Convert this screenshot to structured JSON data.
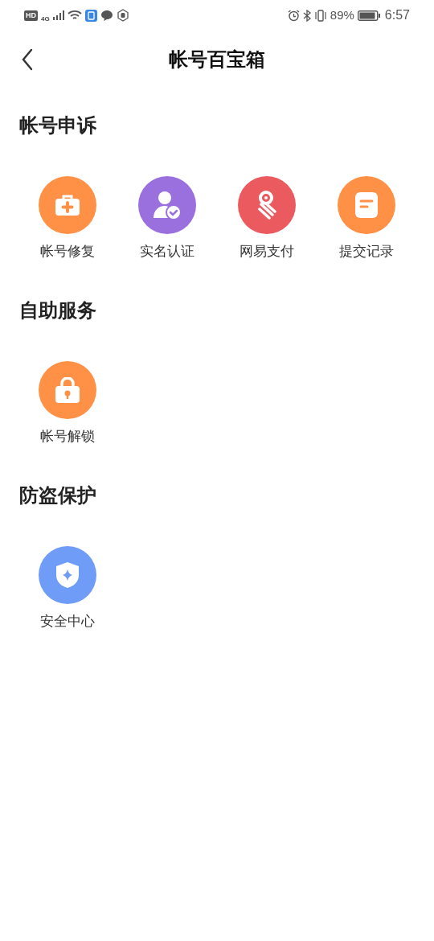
{
  "status_bar": {
    "hd": "HD",
    "network": "4G",
    "battery_percent": "89%",
    "time": "6:57"
  },
  "header": {
    "title": "帐号百宝箱"
  },
  "sections": [
    {
      "title": "帐号申诉",
      "items": [
        {
          "label": "帐号修复",
          "kind": "medkit",
          "color": "#ff9147"
        },
        {
          "label": "实名认证",
          "kind": "user-check",
          "color": "#9a70df"
        },
        {
          "label": "网易支付",
          "kind": "payment",
          "color": "#ea5a5e"
        },
        {
          "label": "提交记录",
          "kind": "document",
          "color": "#ff9147"
        }
      ]
    },
    {
      "title": "自助服务",
      "items": [
        {
          "label": "帐号解锁",
          "kind": "lock",
          "color": "#ff9147"
        }
      ]
    },
    {
      "title": "防盗保护",
      "items": [
        {
          "label": "安全中心",
          "kind": "shield",
          "color": "#6f9cf7"
        }
      ]
    }
  ]
}
